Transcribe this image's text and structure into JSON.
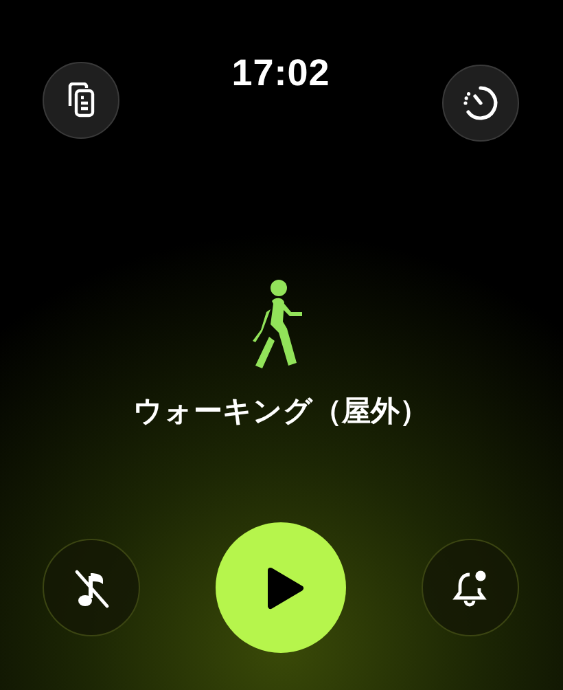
{
  "time": "17:02",
  "workout": {
    "name": "ウォーキング（屋外）"
  }
}
